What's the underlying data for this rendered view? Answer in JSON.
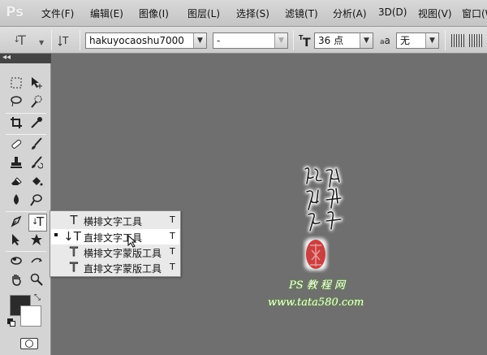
{
  "app": {
    "logo": "Ps"
  },
  "menu": {
    "items": [
      "文件(F)",
      "编辑(E)",
      "图像(I)",
      "图层(L)",
      "选择(S)",
      "滤镜(T)",
      "分析(A)",
      "3D(D)",
      "视图(V)",
      "窗口(W)"
    ]
  },
  "options": {
    "tool_preset_icon": "T",
    "orientation_icon": "change-text-orientation-icon",
    "font_family": "hakuyocaoshu7000",
    "font_style": "-",
    "font_size": "36 点",
    "antialias_symbol": "a",
    "antialias": "无"
  },
  "toolbox": {
    "active_tool_icon": "T"
  },
  "flyout": {
    "items": [
      {
        "label": "横排文字工具",
        "shortcut": "T",
        "icon": "T"
      },
      {
        "label": "直排文字工具",
        "shortcut": "T",
        "icon": "↓T"
      },
      {
        "label": "横排文字蒙版工具",
        "shortcut": "T",
        "icon": "T"
      },
      {
        "label": "直排文字蒙版工具",
        "shortcut": "T",
        "icon": "T"
      }
    ]
  },
  "canvas": {
    "site_name": "PS 教 程 网",
    "site_url": "www.tata580.com"
  },
  "colors": {
    "canvas_bg": "#6f6f6f",
    "foreground": "#2b2b2b",
    "background": "#ffffff",
    "seal": "#c62020",
    "site_glow": "#5aa02a"
  }
}
